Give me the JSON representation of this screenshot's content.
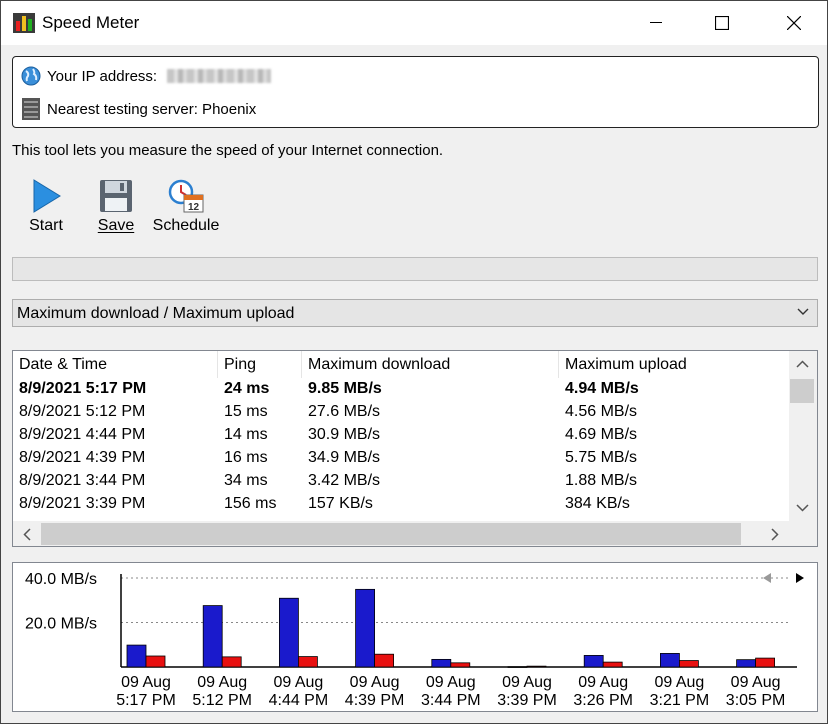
{
  "window": {
    "title": "Speed Meter",
    "icons": {
      "app": "bar-chart-app-icon",
      "minimize": "minimize-icon",
      "maximize": "maximize-icon",
      "close": "close-icon"
    }
  },
  "info": {
    "ip_label": "Your IP address:",
    "server_label": "Nearest testing server: Phoenix"
  },
  "description": "This tool lets you measure the speed of your Internet connection.",
  "toolbar": {
    "start_label": "Start",
    "save_label": "Save",
    "schedule_label": "Schedule"
  },
  "progress": {
    "value": 0
  },
  "view_select": {
    "value": "Maximum download / Maximum upload"
  },
  "table": {
    "columns": [
      "Date & Time",
      "Ping",
      "Maximum download",
      "Maximum upload"
    ],
    "rows": [
      {
        "date": "8/9/2021 5:17 PM",
        "ping": "24 ms",
        "down": "9.85 MB/s",
        "up": "4.94 MB/s",
        "bold": true
      },
      {
        "date": "8/9/2021 5:12 PM",
        "ping": "15 ms",
        "down": "27.6 MB/s",
        "up": "4.56 MB/s"
      },
      {
        "date": "8/9/2021 4:44 PM",
        "ping": "14 ms",
        "down": "30.9 MB/s",
        "up": "4.69 MB/s"
      },
      {
        "date": "8/9/2021 4:39 PM",
        "ping": "16 ms",
        "down": "34.9 MB/s",
        "up": "5.75 MB/s"
      },
      {
        "date": "8/9/2021 3:44 PM",
        "ping": "34 ms",
        "down": "3.42 MB/s",
        "up": "1.88 MB/s"
      },
      {
        "date": "8/9/2021 3:39 PM",
        "ping": "156 ms",
        "down": "157 KB/s",
        "up": "384 KB/s"
      }
    ]
  },
  "chart_data": {
    "type": "bar",
    "categories": [
      [
        "09 Aug",
        "5:17 PM"
      ],
      [
        "09 Aug",
        "5:12 PM"
      ],
      [
        "09 Aug",
        "4:44 PM"
      ],
      [
        "09 Aug",
        "4:39 PM"
      ],
      [
        "09 Aug",
        "3:44 PM"
      ],
      [
        "09 Aug",
        "3:39 PM"
      ],
      [
        "09 Aug",
        "3:26 PM"
      ],
      [
        "09 Aug",
        "3:21 PM"
      ],
      [
        "09 Aug",
        "3:05 PM"
      ]
    ],
    "series": [
      {
        "values": [
          9.85,
          27.6,
          30.9,
          34.9,
          3.42,
          0.157,
          5.2,
          6.1,
          3.3
        ],
        "color": "#1a1acc"
      },
      {
        "values": [
          4.94,
          4.56,
          4.69,
          5.75,
          1.88,
          0.384,
          2.2,
          2.9,
          4.0
        ],
        "color": "#e81010"
      }
    ],
    "yticks": [
      "40.0 MB/s",
      "20.0 MB/s"
    ],
    "ytick_values": [
      40,
      20
    ],
    "ylim": [
      0,
      40
    ]
  }
}
